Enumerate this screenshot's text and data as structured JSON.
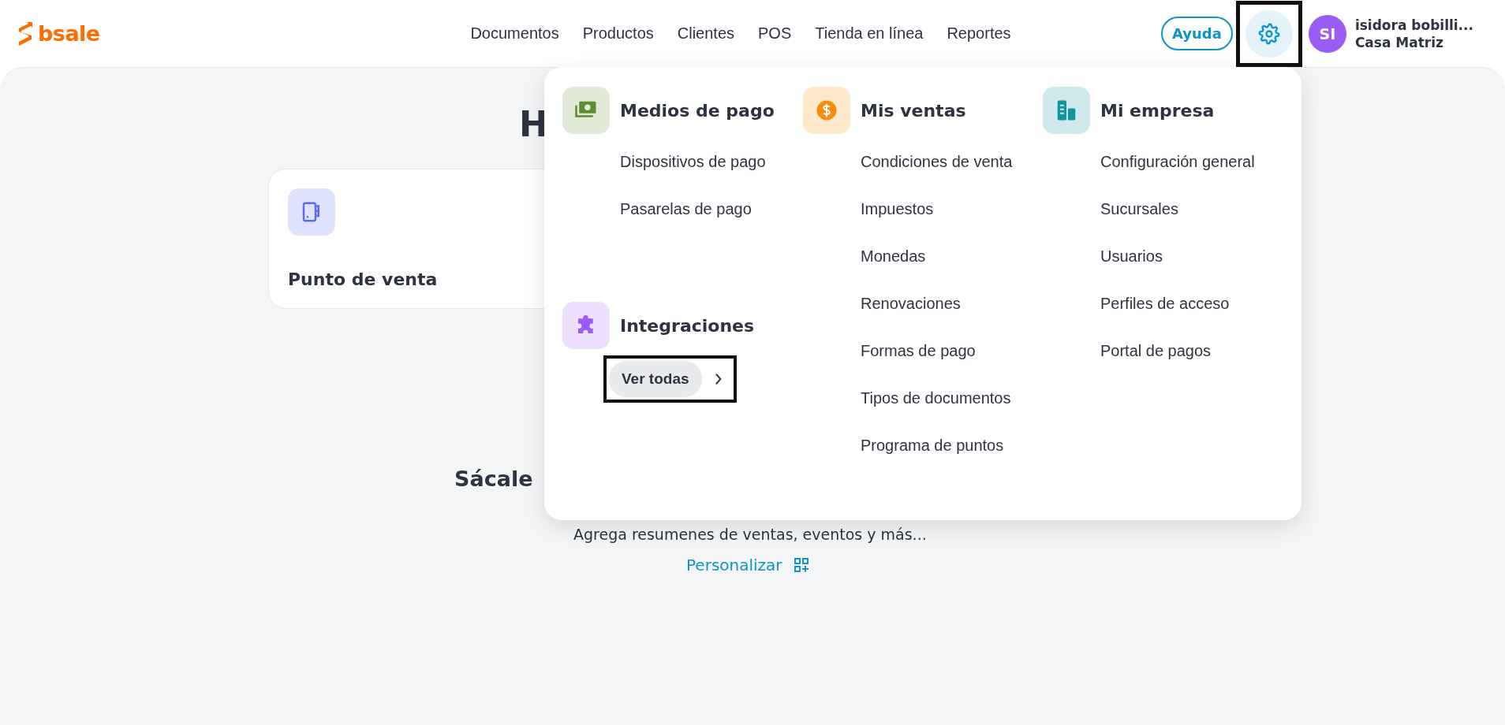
{
  "logo": {
    "text": "bsale"
  },
  "nav": [
    {
      "label": "Documentos"
    },
    {
      "label": "Productos"
    },
    {
      "label": "Clientes"
    },
    {
      "label": "POS"
    },
    {
      "label": "Tienda en línea"
    },
    {
      "label": "Reportes"
    }
  ],
  "help_button": {
    "label": "Ayuda"
  },
  "settings_button": {
    "selected": true,
    "highlighted": true
  },
  "user": {
    "initials": "SI",
    "name": "isidora bobilli...",
    "branch": "Casa Matriz"
  },
  "page": {
    "heading": "H",
    "card": {
      "title": "Punto de venta"
    },
    "promo_title": "Sácale",
    "promo_text": "Agrega resumenes de ventas, eventos y más...",
    "customize_link": "Personalizar"
  },
  "settings_menu": {
    "columns": [
      {
        "sections": [
          {
            "kind": "payments",
            "title": "Medios de pago",
            "items": [
              "Dispositivos de pago",
              "Pasarelas de pago"
            ]
          },
          {
            "kind": "integrations",
            "title": "Integraciones",
            "action": {
              "label": "Ver todas",
              "highlighted": true
            }
          }
        ]
      },
      {
        "sections": [
          {
            "kind": "sales",
            "title": "Mis ventas",
            "items": [
              "Condiciones de venta",
              "Impuestos",
              "Monedas",
              "Renovaciones",
              "Formas de pago",
              "Tipos de documentos",
              "Programa de puntos"
            ]
          }
        ]
      },
      {
        "sections": [
          {
            "kind": "company",
            "title": "Mi empresa",
            "items": [
              "Configuración general",
              "Sucursales",
              "Usuarios",
              "Perfiles de acceso",
              "Portal de pagos"
            ]
          }
        ]
      }
    ]
  }
}
